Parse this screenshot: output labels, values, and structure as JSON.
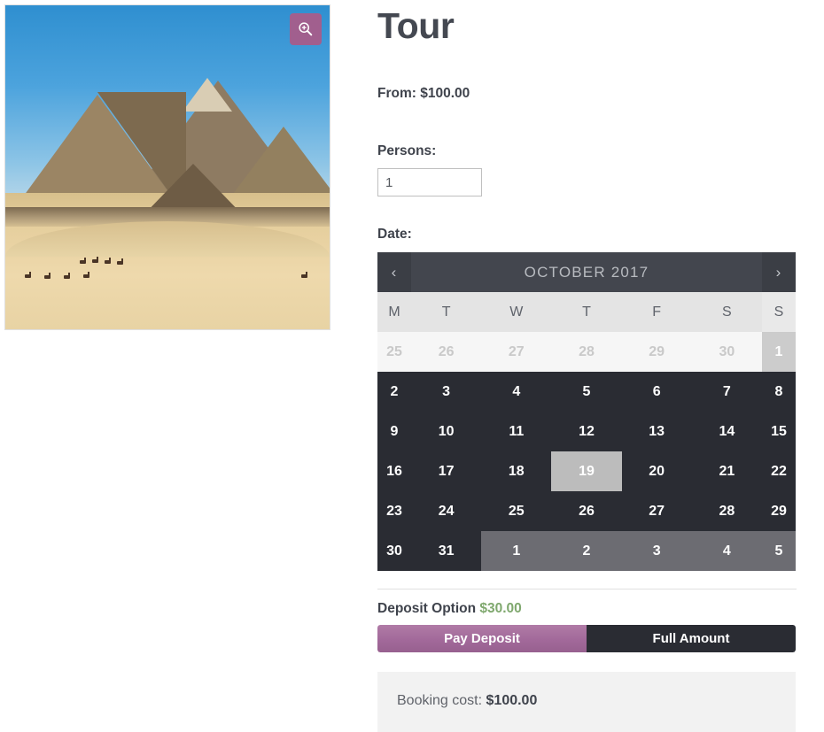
{
  "gallery": {
    "alt": "Pyramids of Giza with camels",
    "zoom_button_title": "Zoom in",
    "zoom_icon": "magnifier-plus-icon"
  },
  "product": {
    "title": "Tour",
    "from_price_label": "From: $100.00"
  },
  "persons": {
    "label": "Persons:",
    "value": "1",
    "placeholder": ""
  },
  "date": {
    "label": "Date:"
  },
  "calendar": {
    "prev_label": "‹",
    "next_label": "›",
    "month_title": "OCTOBER 2017",
    "weekdays": [
      "M",
      "T",
      "W",
      "T",
      "F",
      "S",
      "S"
    ],
    "selected_day": "19",
    "weeks": [
      [
        {
          "day": "25",
          "state": "prev-month"
        },
        {
          "day": "26",
          "state": "prev-month"
        },
        {
          "day": "27",
          "state": "prev-month"
        },
        {
          "day": "28",
          "state": "prev-month"
        },
        {
          "day": "29",
          "state": "prev-month"
        },
        {
          "day": "30",
          "state": "prev-month"
        },
        {
          "day": "1",
          "state": "highlighted"
        }
      ],
      [
        {
          "day": "2",
          "state": "available"
        },
        {
          "day": "3",
          "state": "available"
        },
        {
          "day": "4",
          "state": "available"
        },
        {
          "day": "5",
          "state": "available"
        },
        {
          "day": "6",
          "state": "available"
        },
        {
          "day": "7",
          "state": "available"
        },
        {
          "day": "8",
          "state": "available"
        }
      ],
      [
        {
          "day": "9",
          "state": "available"
        },
        {
          "day": "10",
          "state": "available"
        },
        {
          "day": "11",
          "state": "available"
        },
        {
          "day": "12",
          "state": "available"
        },
        {
          "day": "13",
          "state": "available"
        },
        {
          "day": "14",
          "state": "available"
        },
        {
          "day": "15",
          "state": "available"
        }
      ],
      [
        {
          "day": "16",
          "state": "available"
        },
        {
          "day": "17",
          "state": "available"
        },
        {
          "day": "18",
          "state": "available"
        },
        {
          "day": "19",
          "state": "selected"
        },
        {
          "day": "20",
          "state": "available"
        },
        {
          "day": "21",
          "state": "available"
        },
        {
          "day": "22",
          "state": "available"
        }
      ],
      [
        {
          "day": "23",
          "state": "available"
        },
        {
          "day": "24",
          "state": "available"
        },
        {
          "day": "25",
          "state": "available"
        },
        {
          "day": "26",
          "state": "available"
        },
        {
          "day": "27",
          "state": "available"
        },
        {
          "day": "28",
          "state": "available"
        },
        {
          "day": "29",
          "state": "available"
        }
      ],
      [
        {
          "day": "30",
          "state": "available"
        },
        {
          "day": "31",
          "state": "available"
        },
        {
          "day": "1",
          "state": "next-month"
        },
        {
          "day": "2",
          "state": "next-month"
        },
        {
          "day": "3",
          "state": "next-month"
        },
        {
          "day": "4",
          "state": "next-month"
        },
        {
          "day": "5",
          "state": "next-month"
        }
      ]
    ]
  },
  "deposit": {
    "option_label": "Deposit Option",
    "amount": "$30.00",
    "amount_color": "#7fa86e",
    "pay_deposit_label": "Pay Deposit",
    "full_amount_label": "Full Amount",
    "selected": "Pay Deposit"
  },
  "booking": {
    "cost_label": "Booking cost:",
    "cost_value": "$100.00"
  }
}
